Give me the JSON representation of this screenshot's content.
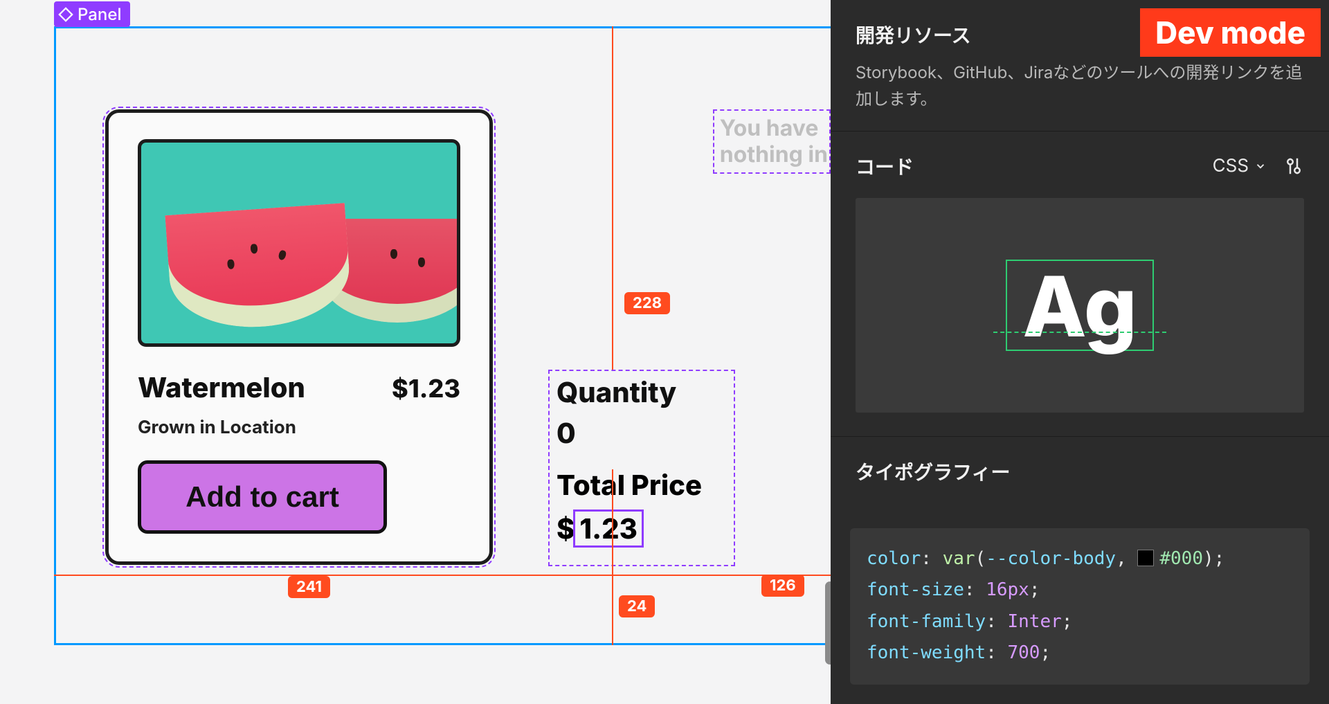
{
  "canvas": {
    "tag_label": "Panel",
    "product": {
      "name": "Watermelon",
      "price": "$1.23",
      "subtitle": "Grown in Location",
      "cta": "Add to cart"
    },
    "summary": {
      "qty_label": "Quantity",
      "qty_value": "0",
      "total_label": "Total Price",
      "total_prefix": "$",
      "total_selected": "1.23"
    },
    "ghost_line1": "You have",
    "ghost_line2": "nothing in",
    "measurements": {
      "top_gap": "228",
      "card_gap": "241",
      "below_gap": "24",
      "right_gap": "126"
    }
  },
  "inspector": {
    "dev_badge": "Dev mode",
    "dev_resources": {
      "title": "開発リソース",
      "desc": "Storybook、GitHub、Jiraなどのツールへの開発リンクを追加します。"
    },
    "code": {
      "title": "コード",
      "lang": "CSS",
      "preview_sample": "Ag"
    },
    "typography": {
      "title": "タイポグラフィー",
      "css": {
        "color_prop": "color",
        "color_fn": "var",
        "color_var": "--color-body",
        "color_hex": "#000",
        "font_size_prop": "font-size",
        "font_size_val": "16px",
        "font_family_prop": "font-family",
        "font_family_val": "Inter",
        "font_weight_prop": "font-weight",
        "font_weight_val": "700"
      }
    }
  }
}
